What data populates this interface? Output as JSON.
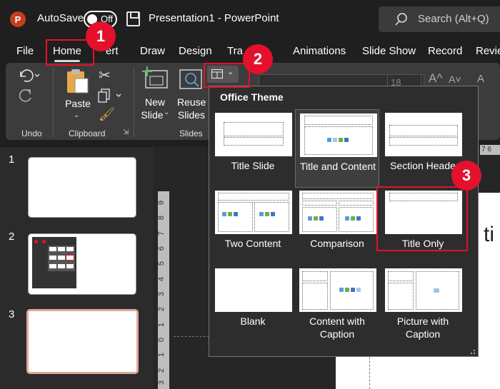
{
  "titlebar": {
    "logo": "P",
    "autosave_label": "AutoSave",
    "autosave_state": "Off",
    "doc_title": "Presentation1  -  PowerPoint",
    "search_placeholder": "Search (Alt+Q)"
  },
  "tabs": [
    "File",
    "Home",
    "Insert",
    "Draw",
    "Design",
    "Transitions",
    "Animations",
    "Slide Show",
    "Record",
    "Review"
  ],
  "tabs_visible_text": [
    "File",
    "Home",
    "ert",
    "Draw",
    "Design",
    "Tra",
    "Animations",
    "Slide Show",
    "Record",
    "Revie"
  ],
  "active_tab": "Home",
  "ribbon": {
    "undo_group": "Undo",
    "clipboard_group": "Clipboard",
    "paste_label": "Paste",
    "slides_group": "Slides",
    "new_slide_label_1": "New",
    "new_slide_label_2": "Slide",
    "reuse_slides_label_1": "Reuse",
    "reuse_slides_label_2": "Slides",
    "font_size": "18"
  },
  "slides": [
    {
      "number": "1"
    },
    {
      "number": "2"
    },
    {
      "number": "3"
    }
  ],
  "ruler_numbers": [
    "9",
    "8",
    "7",
    "6",
    "5",
    "4",
    "3",
    "2",
    "1",
    "0",
    "1",
    "2",
    "3"
  ],
  "top_ruler_text": "7 6",
  "slide_partial_text": "l ti",
  "dropdown": {
    "title": "Office Theme",
    "layouts": [
      {
        "name": "Title Slide"
      },
      {
        "name": "Title and Content"
      },
      {
        "name": "Section Header",
        "visible": "Section Heade"
      },
      {
        "name": "Two Content"
      },
      {
        "name": "Comparison"
      },
      {
        "name": "Title Only"
      },
      {
        "name": "Blank"
      },
      {
        "name": "Content with Caption",
        "line1": "Content with",
        "line2": "Caption"
      },
      {
        "name": "Picture with Caption",
        "line1": "Picture with",
        "line2": "Caption"
      }
    ]
  },
  "callouts": [
    "1",
    "2",
    "3"
  ],
  "colors": {
    "accent_red": "#e3112c",
    "ppt_orange": "#c43e1c",
    "dark_bg": "#1f1f1f"
  }
}
